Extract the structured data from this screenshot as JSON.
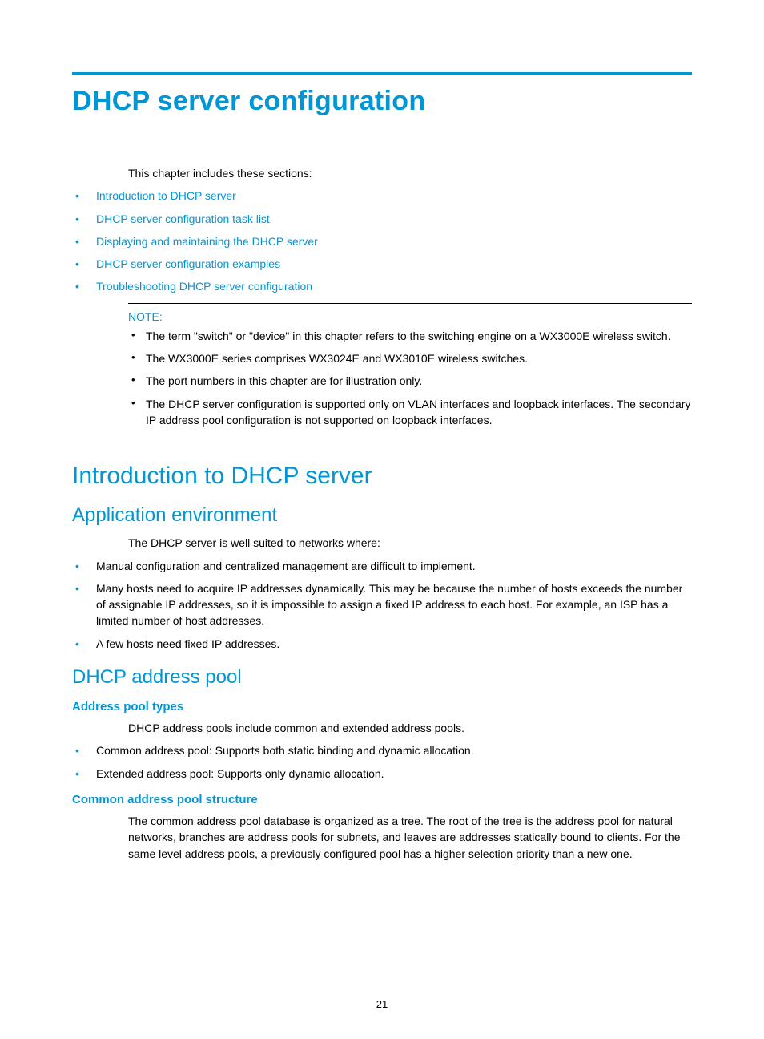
{
  "title": "DHCP server configuration",
  "intro": "This chapter includes these sections:",
  "toc_links": [
    "Introduction to DHCP server",
    "DHCP server configuration task list",
    "Displaying and maintaining the DHCP server",
    "DHCP server configuration examples",
    "Troubleshooting DHCP server configuration"
  ],
  "note": {
    "label": "NOTE:",
    "items": [
      "The term \"switch\" or \"device\" in this chapter refers to the switching engine on a WX3000E wireless switch.",
      "The WX3000E series comprises WX3024E and WX3010E wireless switches.",
      "The port numbers in this chapter are for illustration only.",
      "The DHCP server configuration is supported only on VLAN interfaces and loopback interfaces. The secondary IP address pool configuration is not supported on loopback interfaces."
    ]
  },
  "section_intro": {
    "heading": "Introduction to DHCP server",
    "app_env": {
      "heading": "Application environment",
      "lead": "The DHCP server is well suited to networks where:",
      "bullets": [
        "Manual configuration and centralized management are difficult to implement.",
        "Many hosts need to acquire IP addresses dynamically. This may be because the number of hosts exceeds the number of assignable IP addresses, so it is impossible to assign a fixed IP address to each host. For example, an ISP has a limited number of host addresses.",
        "A few hosts need fixed IP addresses."
      ]
    },
    "pool": {
      "heading": "DHCP address pool",
      "types": {
        "heading": "Address pool types",
        "lead": "DHCP address pools include common and extended address pools.",
        "bullets": [
          "Common address pool: Supports both static binding and dynamic allocation.",
          "Extended address pool: Supports only dynamic allocation."
        ]
      },
      "structure": {
        "heading": "Common address pool structure",
        "body": "The common address pool database is organized as a tree. The root of the tree is the address pool for natural networks, branches are address pools for subnets, and leaves are addresses statically bound to clients. For the same level address pools, a previously configured pool has a higher selection priority than a new one."
      }
    }
  },
  "page_number": "21"
}
